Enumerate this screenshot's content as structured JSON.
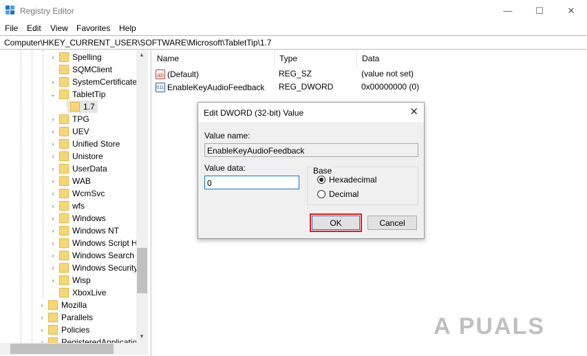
{
  "window": {
    "title": "Registry Editor",
    "icon": "registry-icon"
  },
  "menu": [
    "File",
    "Edit",
    "View",
    "Favorites",
    "Help"
  ],
  "address": "Computer\\HKEY_CURRENT_USER\\SOFTWARE\\Microsoft\\TabletTip\\1.7",
  "tree": [
    {
      "label": "Spelling"
    },
    {
      "label": "SQMClient"
    },
    {
      "label": "SystemCertificate"
    },
    {
      "label": "TabletTip",
      "expanded": true
    },
    {
      "label": "1.7",
      "selected": true
    },
    {
      "label": "TPG"
    },
    {
      "label": "UEV"
    },
    {
      "label": "Unified Store"
    },
    {
      "label": "Unistore"
    },
    {
      "label": "UserData"
    },
    {
      "label": "WAB"
    },
    {
      "label": "WcmSvc"
    },
    {
      "label": "wfs"
    },
    {
      "label": "Windows"
    },
    {
      "label": "Windows NT"
    },
    {
      "label": "Windows Script H"
    },
    {
      "label": "Windows Search"
    },
    {
      "label": "Windows Security"
    },
    {
      "label": "Wisp"
    },
    {
      "label": "XboxLive"
    },
    {
      "label": "Mozilla"
    },
    {
      "label": "Parallels"
    },
    {
      "label": "Policies"
    },
    {
      "label": "RegisteredApplicatio"
    }
  ],
  "list": {
    "columns": [
      "Name",
      "Type",
      "Data"
    ],
    "rows": [
      {
        "name": "(Default)",
        "type": "REG_SZ",
        "data": "(value not set)",
        "icon": "string-value-icon"
      },
      {
        "name": "EnableKeyAudioFeedback",
        "type": "REG_DWORD",
        "data": "0x00000000 (0)",
        "icon": "binary-value-icon"
      }
    ]
  },
  "dialog": {
    "title": "Edit DWORD (32-bit) Value",
    "value_name_label": "Value name:",
    "value_name": "EnableKeyAudioFeedback",
    "value_data_label": "Value data:",
    "value_data": "0",
    "base_label": "Base",
    "hex_label": "Hexadecimal",
    "dec_label": "Decimal",
    "selected_base": "Hexadecimal",
    "ok_label": "OK",
    "cancel_label": "Cancel"
  },
  "watermark": "A PUALS",
  "colors": {
    "highlight": "#e31b23",
    "focus": "#0078d7",
    "folder": "#f6d675"
  }
}
